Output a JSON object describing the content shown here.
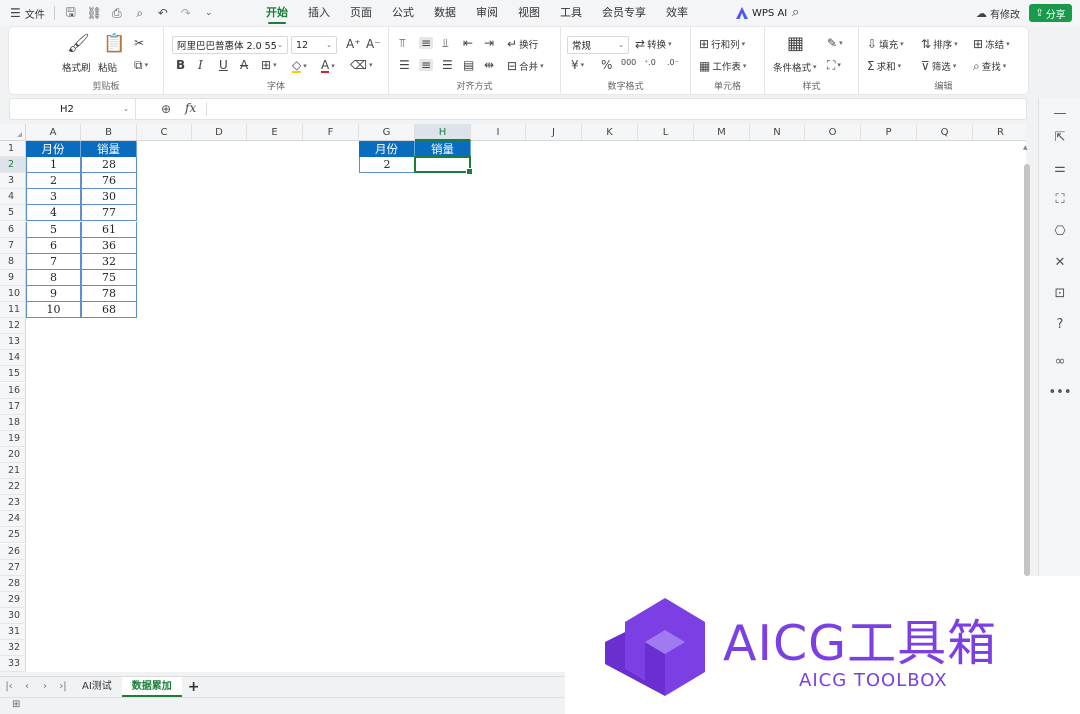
{
  "menubar": {
    "file_label": "文件",
    "tabs": [
      "开始",
      "插入",
      "页面",
      "公式",
      "数据",
      "审阅",
      "视图",
      "工具",
      "会员专享",
      "效率"
    ],
    "active_tab": "开始",
    "wps_ai": "WPS AI",
    "modified": "有修改",
    "share": "分享"
  },
  "ribbon": {
    "clipboard": {
      "label": "剪贴板",
      "format_painter": "格式刷",
      "paste": "粘贴"
    },
    "font": {
      "label": "字体",
      "font_name": "阿里巴巴普惠体 2.0 55",
      "font_size": "12"
    },
    "alignment": {
      "label": "对齐方式",
      "wrap": "换行",
      "merge": "合并"
    },
    "number": {
      "label": "数字格式",
      "format": "常规",
      "convert": "转换"
    },
    "cells": {
      "label": "单元格",
      "row_col": "行和列",
      "worksheet": "工作表"
    },
    "styles": {
      "label": "样式",
      "conditional": "条件格式"
    },
    "editing": {
      "label": "编辑",
      "fill": "填充",
      "sort": "排序",
      "freeze": "冻结",
      "sum": "求和",
      "filter": "筛选",
      "find": "查找"
    }
  },
  "formula_bar": {
    "name_box": "H2",
    "fx": "fx",
    "content": ""
  },
  "grid": {
    "columns": [
      "A",
      "B",
      "C",
      "D",
      "E",
      "F",
      "G",
      "H",
      "I",
      "J",
      "K",
      "L",
      "M",
      "N",
      "O",
      "P",
      "Q",
      "R"
    ],
    "rows": [
      "1",
      "2",
      "3",
      "4",
      "5",
      "6",
      "7",
      "8",
      "9",
      "10",
      "11",
      "12",
      "13",
      "14",
      "15",
      "16",
      "17",
      "18",
      "19",
      "20",
      "21",
      "22",
      "23",
      "24",
      "25",
      "26",
      "27",
      "28",
      "29",
      "30",
      "31",
      "32",
      "33"
    ],
    "selected_cell": "H2",
    "table1": {
      "headers": [
        "月份",
        "销量"
      ],
      "rows": [
        [
          "1",
          "28"
        ],
        [
          "2",
          "76"
        ],
        [
          "3",
          "30"
        ],
        [
          "4",
          "77"
        ],
        [
          "5",
          "61"
        ],
        [
          "6",
          "36"
        ],
        [
          "7",
          "32"
        ],
        [
          "8",
          "75"
        ],
        [
          "9",
          "78"
        ],
        [
          "10",
          "68"
        ]
      ]
    },
    "table2": {
      "headers": [
        "月份",
        "销量"
      ],
      "rows": [
        [
          "2",
          ""
        ]
      ]
    }
  },
  "sheets": {
    "tabs": [
      "AI测试",
      "数据累加"
    ],
    "active": "数据累加"
  },
  "watermark": {
    "title": "AICG工具箱",
    "subtitle": "AICG TOOLBOX"
  },
  "colors": {
    "accent": "#1a7f3c",
    "header_fill": "#0a6cbf",
    "brand": "#7b3fe4"
  }
}
